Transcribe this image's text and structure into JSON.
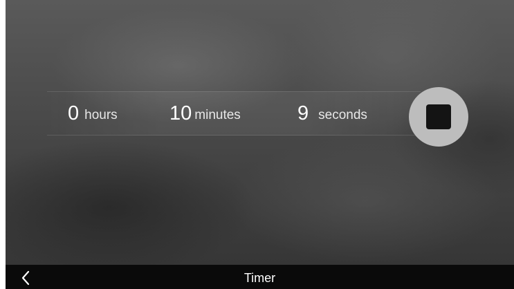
{
  "timer": {
    "hours_value": "0",
    "hours_label": "hours",
    "minutes_value": "10",
    "minutes_label": "minutes",
    "seconds_value": "9",
    "seconds_label": "seconds"
  },
  "controls": {
    "stop_icon": "stop-icon",
    "stop_button_color": "#bdbdbd"
  },
  "bottom_bar": {
    "back_icon": "chevron-left-icon",
    "title": "Timer"
  }
}
